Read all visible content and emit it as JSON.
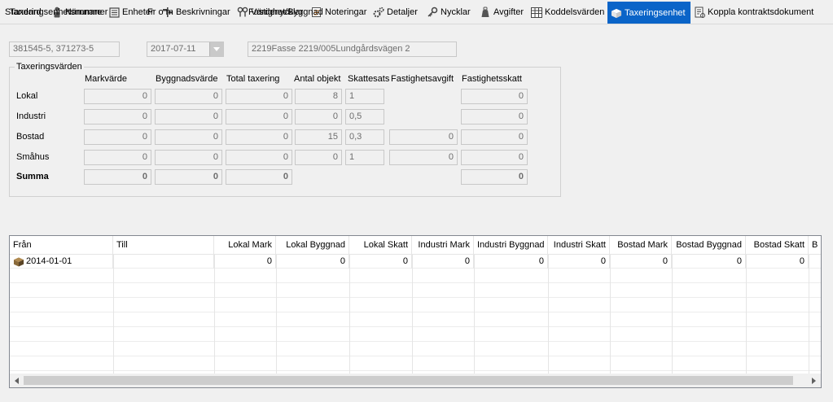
{
  "tabs": [
    {
      "label": "Standard",
      "icon": "none"
    },
    {
      "label": "Nämnare",
      "icon": "person-icon"
    },
    {
      "label": "Enheter",
      "icon": "units-icon"
    },
    {
      "label": "Beskrivningar",
      "icon": "signpost-icon"
    },
    {
      "label": "Värdenycklar",
      "icon": "keys-icon"
    },
    {
      "label": "Noteringar",
      "icon": "notes-icon"
    },
    {
      "label": "Detaljer",
      "icon": "gears-icon"
    },
    {
      "label": "Nycklar",
      "icon": "key-icon"
    },
    {
      "label": "Avgifter",
      "icon": "fee-icon"
    },
    {
      "label": "Koddelsvärden",
      "icon": "table-icon"
    },
    {
      "label": "Taxeringsenhet",
      "icon": "box-icon",
      "active": true
    },
    {
      "label": "Koppla kontraktsdokument",
      "icon": "document-link-icon"
    }
  ],
  "header": {
    "unit_number_label": "Taxeringsenhetsnummer",
    "unit_number_value": "381545-5, 371273-5",
    "from_label": "Fr o m",
    "from_value": "2017-07-11",
    "property_label": "Fastighet/Byggnad",
    "property_value": "2219Fasse 2219/005Lundgårdsvägen 2"
  },
  "values_group": {
    "title": "Taxeringsvärden",
    "columns": [
      "Markvärde",
      "Byggnadsvärde",
      "Total taxering",
      "Antal objekt",
      "Skattesats",
      "Fastighetsavgift",
      "Fastighetsskatt"
    ],
    "rows": [
      {
        "label": "Lokal",
        "markvarde": "0",
        "byggnadsvarde": "0",
        "total": "0",
        "antal": "8",
        "skattesats": "1",
        "avgift": null,
        "skatt": "0"
      },
      {
        "label": "Industri",
        "markvarde": "0",
        "byggnadsvarde": "0",
        "total": "0",
        "antal": "0",
        "skattesats": "0,5",
        "avgift": null,
        "skatt": "0"
      },
      {
        "label": "Bostad",
        "markvarde": "0",
        "byggnadsvarde": "0",
        "total": "0",
        "antal": "15",
        "skattesats": "0,3",
        "avgift": "0",
        "skatt": "0"
      },
      {
        "label": "Småhus",
        "markvarde": "0",
        "byggnadsvarde": "0",
        "total": "0",
        "antal": "0",
        "skattesats": "1",
        "avgift": "0",
        "skatt": "0"
      }
    ],
    "summa": {
      "label": "Summa",
      "markvarde": "0",
      "byggnadsvarde": "0",
      "total": "0",
      "skatt": "0"
    }
  },
  "grid": {
    "columns": [
      "Från",
      "Till",
      "Lokal Mark",
      "Lokal Byggnad",
      "Lokal Skatt",
      "Industri Mark",
      "Industri Byggnad",
      "Industri Skatt",
      "Bostad Mark",
      "Bostad Byggnad",
      "Bostad Skatt",
      "B"
    ],
    "rows": [
      {
        "fran": "2014-01-01",
        "till": "",
        "values": [
          "0",
          "0",
          "0",
          "0",
          "0",
          "0",
          "0",
          "0",
          "0"
        ]
      }
    ]
  }
}
